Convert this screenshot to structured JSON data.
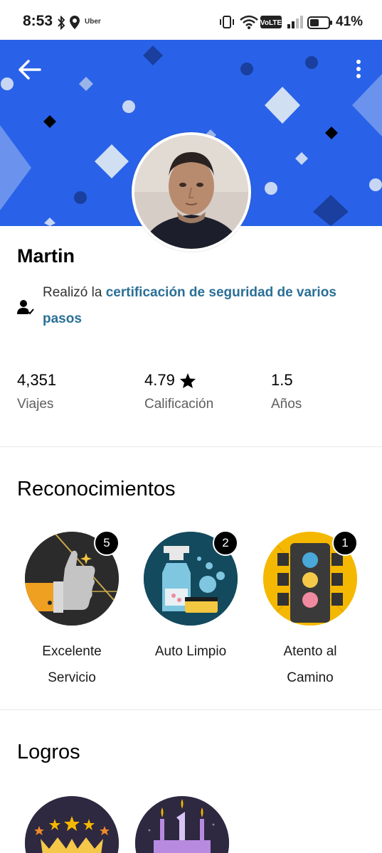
{
  "status_bar": {
    "time": "8:53",
    "app_label": "Uber",
    "battery": "41%"
  },
  "colors": {
    "banner": "#2962e8",
    "link": "#2a6f97",
    "badge_count_bg": "#000000"
  },
  "driver": {
    "name": "Martin",
    "cert_prefix": "Realizó la ",
    "cert_link": "certificación de seguridad de varios pasos"
  },
  "stats": [
    {
      "value": "4,351",
      "label": "Viajes"
    },
    {
      "value": "4.79",
      "label": "Calificación",
      "icon": "star-icon"
    },
    {
      "value": "1.5",
      "label": "Años"
    }
  ],
  "recognitions": {
    "title": "Reconocimientos",
    "items": [
      {
        "count": "5",
        "label_line1": "Excelente",
        "label_line2": "Servicio",
        "icon": "thumbs-up-icon"
      },
      {
        "count": "2",
        "label_line1": "Auto Limpio",
        "label_line2": "",
        "icon": "spray-bottle-icon"
      },
      {
        "count": "1",
        "label_line1": "Atento al",
        "label_line2": "Camino",
        "icon": "traffic-light-icon"
      }
    ]
  },
  "achievements": {
    "title": "Logros",
    "items": [
      {
        "icon": "crown-stars-icon"
      },
      {
        "icon": "birthday-cake-icon"
      }
    ]
  }
}
